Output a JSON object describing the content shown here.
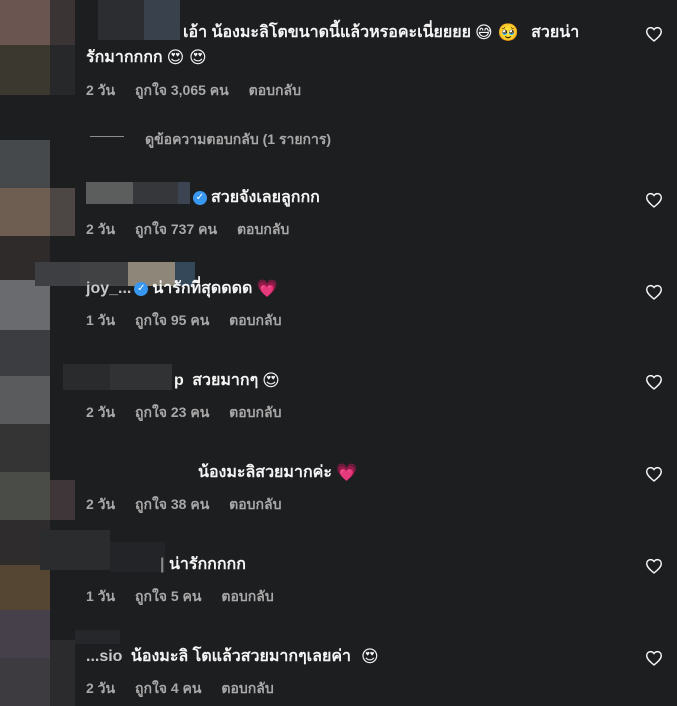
{
  "comments": [
    {
      "text_line1": "เอ้า น้องมะลิโตขนาดนี้แล้วหรอคะเนี่ยยยย",
      "emoji_line1": "😅 🥹",
      "text_line1b": "สวยน่า",
      "text_line2": "รักมากกกก",
      "emoji_line2": "😍 😍",
      "time": "2 วัน",
      "likes": "ถูกใจ 3,065 คน",
      "reply": "ตอบกลับ"
    },
    {
      "username": "",
      "text": "สวยจังเลยลูกกก",
      "time": "2 วัน",
      "likes": "ถูกใจ 737 คน",
      "reply": "ตอบกลับ"
    },
    {
      "username": "joy_...",
      "text": "น่ารักที่สุดดดด",
      "emoji": "💗",
      "time": "1 วัน",
      "likes": "ถูกใจ 95 คน",
      "reply": "ตอบกลับ"
    },
    {
      "username": "p",
      "text": "สวยมากๆ",
      "emoji": "😍",
      "time": "2 วัน",
      "likes": "ถูกใจ 23 คน",
      "reply": "ตอบกลับ"
    },
    {
      "username": "",
      "text": "น้องมะลิสวยมากค่ะ",
      "emoji": "💗",
      "time": "2 วัน",
      "likes": "ถูกใจ 38 คน",
      "reply": "ตอบกลับ"
    },
    {
      "username": "",
      "text": "น่ารักกกกก",
      "time": "1 วัน",
      "likes": "ถูกใจ 5 คน",
      "reply": "ตอบกลับ"
    },
    {
      "username": "...sio",
      "text": "น้องมะลิ โตแล้วสวยมากๆเลยค่า",
      "emoji": "😍",
      "time": "2 วัน",
      "likes": "ถูกใจ 4 คน",
      "reply": "ตอบกลับ"
    }
  ],
  "view_replies": "ดูข้อความตอบกลับ (1 รายการ)",
  "icons": {
    "like": "heart-outline-icon",
    "verified": "verified-badge-icon"
  },
  "colors": {
    "background": "#1d1e20",
    "text": "#f5f5f5",
    "meta": "#a8a8a8",
    "verified": "#3897f0",
    "heart_emoji": "#f33e6b"
  }
}
